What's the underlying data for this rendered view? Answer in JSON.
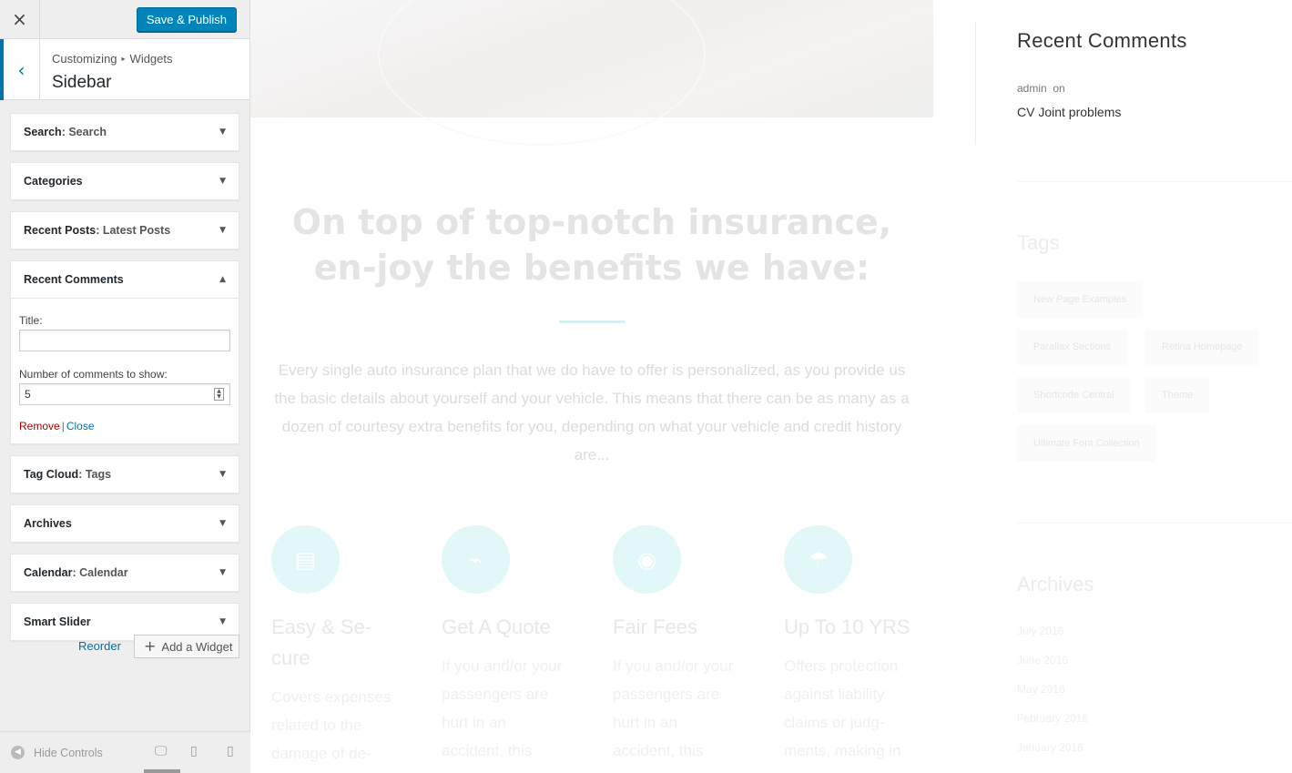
{
  "topbar": {
    "close_icon": "×",
    "publish_label": "Save & Publish"
  },
  "section": {
    "back_icon": "‹",
    "breadcrumb_root": "Customizing",
    "breadcrumb_sep": "▸",
    "breadcrumb_current": "Widgets",
    "title": "Sidebar"
  },
  "widgets": [
    {
      "title": "Search",
      "subtitle": ": Search"
    },
    {
      "title": "Categories",
      "subtitle": ""
    },
    {
      "title": "Recent Posts",
      "subtitle": ": Latest Posts"
    },
    {
      "title": "Recent Comments",
      "subtitle": ""
    },
    {
      "title": "Tag Cloud",
      "subtitle": ": Tags"
    },
    {
      "title": "Archives",
      "subtitle": ""
    },
    {
      "title": "Calendar",
      "subtitle": ": Calendar"
    },
    {
      "title": "Smart Slider",
      "subtitle": ""
    }
  ],
  "recent_comments_form": {
    "title_label": "Title:",
    "title_value": "",
    "count_label": "Number of comments to show:",
    "count_value": "5",
    "remove_label": "Remove",
    "pipe": "|",
    "close_label": "Close"
  },
  "widget_actions": {
    "reorder_label": "Reorder",
    "add_label": "Add a Widget",
    "add_icon": "+"
  },
  "footer": {
    "hide_controls_label": "Hide Controls",
    "device_active": "desktop"
  },
  "preview": {
    "headline": "On top of top-notch insurance, en-joy the benefits we have:",
    "lead": "Every single auto insurance plan that we do have to offer is personalized, as you provide us the basic details about yourself and your vehicle. This means that there can be as many as a dozen of courtesy extra benefits for you, depending on what your vehicle and credit history are...",
    "features": [
      {
        "title": "Easy & Se-cure",
        "text": "Covers expenses related to the damage of de-",
        "icon": "document-icon"
      },
      {
        "title": "Get A Quote",
        "text": "If you and/or your passengers are hurt in an accident, this",
        "icon": "pulse-icon"
      },
      {
        "title": "Fair Fees",
        "text": "If you and/or your passengers are hurt in an accident, this",
        "icon": "user-icon"
      },
      {
        "title": "Up To 10 YRS",
        "text": "Offers protection against liability claims or judg-ments, making in",
        "icon": "umbrella-icon"
      }
    ],
    "sidebar": {
      "recent_comments_title": "Recent Comments",
      "comment_author": "admin",
      "comment_on": "on",
      "comment_link": "CV Joint problems",
      "tags_title": "Tags",
      "tags": [
        "New Page Examples",
        "Parallax Sections",
        "Retina Homepage",
        "Shortcode Central",
        "Theme",
        "Ultimate Font Collection"
      ],
      "archives_title": "Archives",
      "archives": [
        "July 2016",
        "June 2016",
        "May 2016",
        "February 2016",
        "January 2016"
      ]
    }
  }
}
